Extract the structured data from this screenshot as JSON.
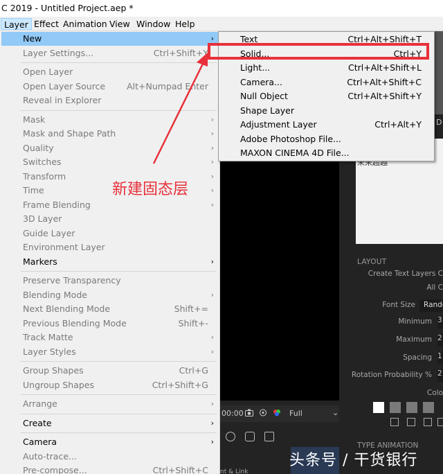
{
  "window": {
    "title": "C 2019 - Untitled Project.aep *"
  },
  "menubar": [
    "Layer",
    "Effect",
    "Animation",
    "View",
    "Window",
    "Help"
  ],
  "layer_menu": {
    "groups": [
      [
        {
          "label": "New",
          "shortcut": "",
          "submenu": true,
          "enabled": true,
          "highlighted": true
        },
        {
          "label": "Layer Settings...",
          "shortcut": "Ctrl+Shift+Y",
          "submenu": false,
          "enabled": false
        }
      ],
      [
        {
          "label": "Open Layer",
          "shortcut": "",
          "submenu": false,
          "enabled": false
        },
        {
          "label": "Open Layer Source",
          "shortcut": "Alt+Numpad Enter",
          "submenu": false,
          "enabled": false
        },
        {
          "label": "Reveal in Explorer",
          "shortcut": "",
          "submenu": false,
          "enabled": false
        }
      ],
      [
        {
          "label": "Mask",
          "shortcut": "",
          "submenu": true,
          "enabled": false
        },
        {
          "label": "Mask and Shape Path",
          "shortcut": "",
          "submenu": true,
          "enabled": false
        },
        {
          "label": "Quality",
          "shortcut": "",
          "submenu": true,
          "enabled": false
        },
        {
          "label": "Switches",
          "shortcut": "",
          "submenu": true,
          "enabled": false
        },
        {
          "label": "Transform",
          "shortcut": "",
          "submenu": true,
          "enabled": false
        },
        {
          "label": "Time",
          "shortcut": "",
          "submenu": true,
          "enabled": false
        },
        {
          "label": "Frame Blending",
          "shortcut": "",
          "submenu": true,
          "enabled": false
        },
        {
          "label": "3D Layer",
          "shortcut": "",
          "submenu": false,
          "enabled": false
        },
        {
          "label": "Guide Layer",
          "shortcut": "",
          "submenu": false,
          "enabled": false
        },
        {
          "label": "Environment Layer",
          "shortcut": "",
          "submenu": false,
          "enabled": false
        },
        {
          "label": "Markers",
          "shortcut": "",
          "submenu": true,
          "enabled": true
        }
      ],
      [
        {
          "label": "Preserve Transparency",
          "shortcut": "",
          "submenu": false,
          "enabled": false
        },
        {
          "label": "Blending Mode",
          "shortcut": "",
          "submenu": true,
          "enabled": false
        },
        {
          "label": "Next Blending Mode",
          "shortcut": "Shift+=",
          "submenu": false,
          "enabled": false
        },
        {
          "label": "Previous Blending Mode",
          "shortcut": "Shift+-",
          "submenu": false,
          "enabled": false
        },
        {
          "label": "Track Matte",
          "shortcut": "",
          "submenu": true,
          "enabled": false
        },
        {
          "label": "Layer Styles",
          "shortcut": "",
          "submenu": true,
          "enabled": false
        }
      ],
      [
        {
          "label": "Group Shapes",
          "shortcut": "Ctrl+G",
          "submenu": false,
          "enabled": false
        },
        {
          "label": "Ungroup Shapes",
          "shortcut": "Ctrl+Shift+G",
          "submenu": false,
          "enabled": false
        }
      ],
      [
        {
          "label": "Arrange",
          "shortcut": "",
          "submenu": true,
          "enabled": false
        }
      ],
      [
        {
          "label": "Create",
          "shortcut": "",
          "submenu": true,
          "enabled": true
        }
      ],
      [
        {
          "label": "Camera",
          "shortcut": "",
          "submenu": true,
          "enabled": true
        },
        {
          "label": "Auto-trace...",
          "shortcut": "",
          "submenu": false,
          "enabled": false
        },
        {
          "label": "Pre-compose...",
          "shortcut": "Ctrl+Shift+C",
          "submenu": false,
          "enabled": false
        }
      ]
    ]
  },
  "new_submenu": [
    {
      "label": "Text",
      "shortcut": "Ctrl+Alt+Shift+T"
    },
    {
      "label": "Solid...",
      "shortcut": "Ctrl+Y"
    },
    {
      "label": "Light...",
      "shortcut": "Ctrl+Alt+Shift+L"
    },
    {
      "label": "Camera...",
      "shortcut": "Ctrl+Alt+Shift+C"
    },
    {
      "label": "Null Object",
      "shortcut": "Ctrl+Alt+Shift+Y"
    },
    {
      "label": "Shape Layer",
      "shortcut": ""
    },
    {
      "label": "Adjustment Layer",
      "shortcut": "Ctrl+Alt+Y"
    },
    {
      "label": "Adobe Photoshop File...",
      "shortcut": ""
    },
    {
      "label": "MAXON CINEMA 4D File...",
      "shortcut": ""
    }
  ],
  "annotation": {
    "text": "新建固态层",
    "color": "#e8303a"
  },
  "background": {
    "thumb_label": "D",
    "project_text": "未来超越",
    "viewer_zoom": "00:00",
    "viewer_resolution": "Full",
    "timeline_tab": "nt & Link",
    "layout_title": "LAYOUT",
    "create_text_layers": "Create Text Layers C",
    "all_c": "All C",
    "font_size_label": "Font Size",
    "font_size_value": "Rando",
    "minimum_label": "Minimum",
    "minimum_value": "3",
    "maximum_label": "Maximum",
    "maximum_value": "2",
    "spacing_label": "Spacing",
    "spacing_value": "1",
    "rotation_label": "Rotation Probability %",
    "rotation_value": "2",
    "color_label": "Colo",
    "type_animation": "TYPE ANIMATION"
  },
  "watermark": "头条号 / 干货银行",
  "colors": {
    "menu_bg": "#f0f0f0",
    "highlight": "#91c9f7",
    "annotation": "#e8303a",
    "app_bg": "#232323"
  }
}
